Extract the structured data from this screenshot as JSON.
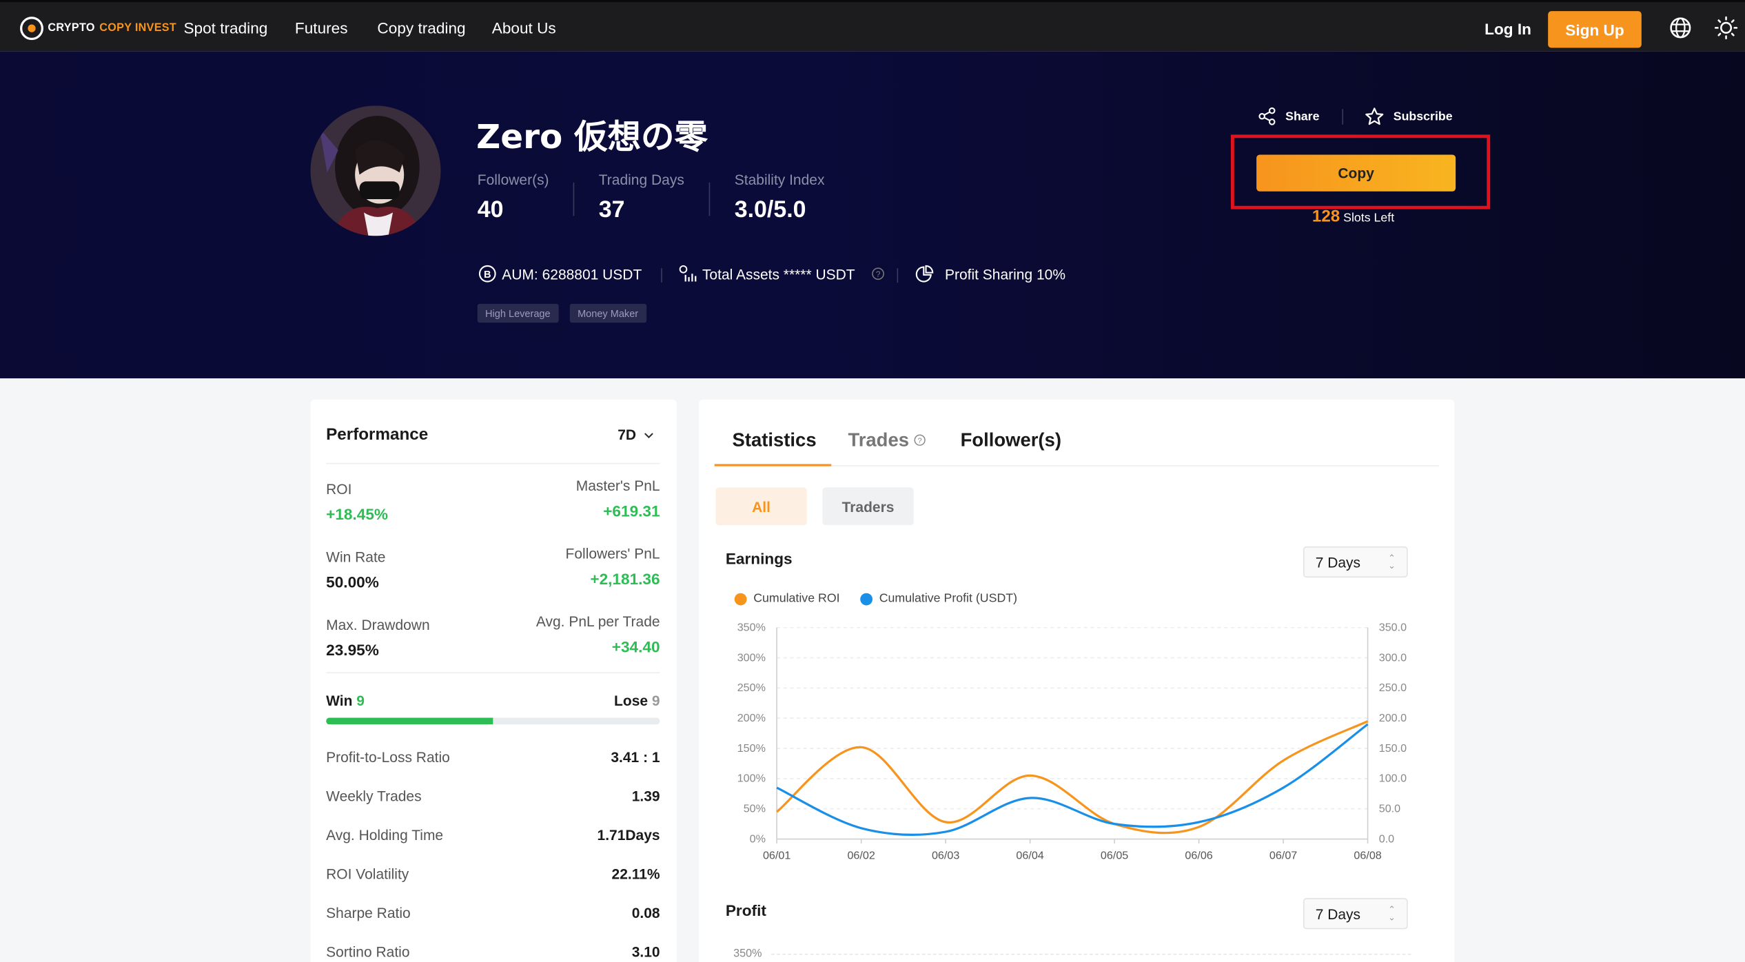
{
  "nav": {
    "logo_part1": "CRYPTO",
    "logo_part2": "COPY INVEST",
    "items": [
      "Spot trading",
      "Futures",
      "Copy trading",
      "About Us"
    ],
    "login": "Log In",
    "signup": "Sign Up",
    "icons": [
      "globe-icon",
      "sun-icon"
    ]
  },
  "trader": {
    "name": "Zero 仮想の零",
    "stats": [
      {
        "label": "Follower(s)",
        "value": "40"
      },
      {
        "label": "Trading Days",
        "value": "37"
      },
      {
        "label": "Stability Index",
        "value": "3.0/5.0"
      }
    ],
    "aum": "AUM: 6288801 USDT",
    "total_assets": "Total Assets ***** USDT",
    "profit_sharing": "Profit Sharing 10%",
    "tags": [
      "High Leverage",
      "Money Maker"
    ],
    "share": "Share",
    "subscribe": "Subscribe",
    "copy": "Copy",
    "slots_count": "128",
    "slots_text": "Slots Left"
  },
  "performance": {
    "title": "Performance",
    "period": "7D",
    "pairs": [
      {
        "label": "ROI",
        "value": "+18.45%",
        "rlabel": "Master's PnL",
        "rvalue": "+619.31"
      },
      {
        "label": "Win Rate",
        "value": "50.00%",
        "rlabel": "Followers' PnL",
        "rvalue": "+2,181.36"
      },
      {
        "label": "Max. Drawdown",
        "value": "23.95%",
        "rlabel": "Avg. PnL per Trade",
        "rvalue": "+34.40"
      }
    ],
    "win_label": "Win",
    "win_count": "9",
    "lose_label": "Lose",
    "lose_count": "9",
    "win_ratio": 0.5,
    "rows": [
      {
        "label": "Profit-to-Loss Ratio",
        "value": "3.41 : 1"
      },
      {
        "label": "Weekly Trades",
        "value": "1.39"
      },
      {
        "label": "Avg. Holding Time",
        "value": "1.71Days"
      },
      {
        "label": "ROI Volatility",
        "value": "22.11%"
      },
      {
        "label": "Sharpe Ratio",
        "value": "0.08"
      },
      {
        "label": "Sortino Ratio",
        "value": "3.10"
      }
    ]
  },
  "statistics": {
    "tabs": [
      "Statistics",
      "Trades",
      "Follower(s)"
    ],
    "filters": [
      "All",
      "Traders"
    ],
    "earnings_title": "Earnings",
    "profit_title": "Profit",
    "range": "7 Days",
    "profit_axis_top": "350%"
  },
  "colors": {
    "accent": "#f7941d",
    "blue": "#1a8fe8",
    "green": "#2ebd55"
  },
  "chart_data": {
    "type": "line",
    "title": "Earnings",
    "x": [
      "06/01",
      "06/02",
      "06/03",
      "06/04",
      "06/05",
      "06/06",
      "06/07",
      "06/08"
    ],
    "series": [
      {
        "name": "Cumulative ROI",
        "axis": "left",
        "unit": "%",
        "values": [
          45,
          152,
          28,
          105,
          25,
          20,
          130,
          195
        ]
      },
      {
        "name": "Cumulative Profit (USDT)",
        "axis": "right",
        "values": [
          85,
          18,
          12,
          68,
          25,
          28,
          85,
          190
        ]
      }
    ],
    "y_left_ticks": [
      "0%",
      "50%",
      "100%",
      "150%",
      "200%",
      "250%",
      "300%",
      "350%"
    ],
    "y_right_ticks": [
      "0.0",
      "50.0",
      "100.0",
      "150.0",
      "200.0",
      "250.0",
      "300.0",
      "350.0"
    ],
    "ylim": [
      0,
      350
    ],
    "grid": true,
    "legend": "top-left"
  }
}
